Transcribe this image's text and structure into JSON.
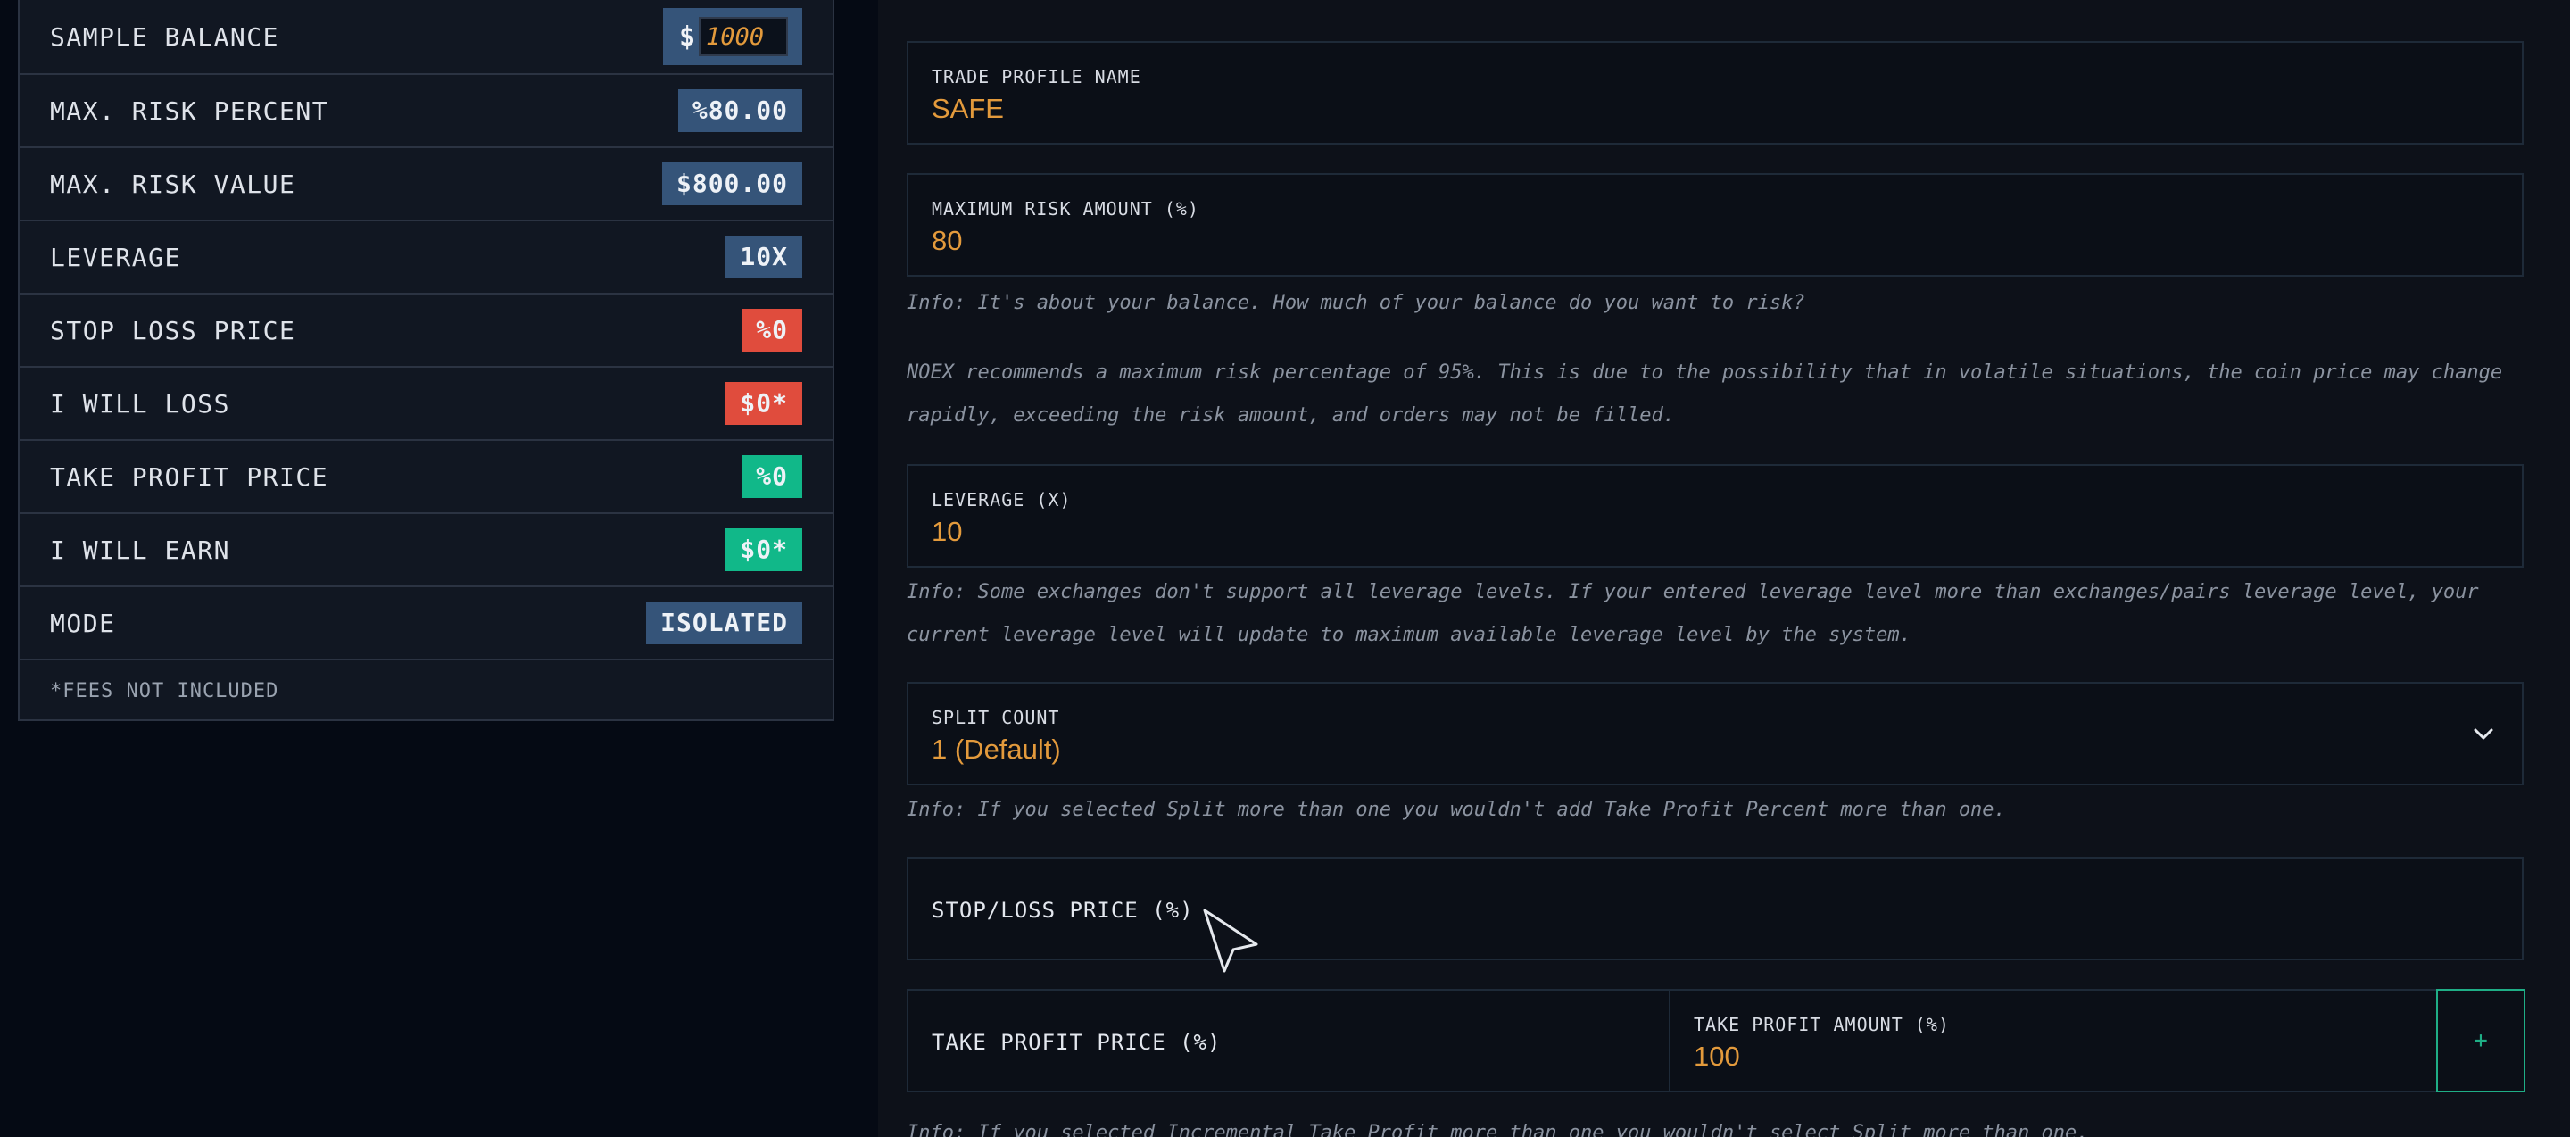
{
  "summary": {
    "rows": [
      {
        "label": "SAMPLE BALANCE",
        "currency": "$",
        "value": "1000"
      },
      {
        "label": "MAX. RISK PERCENT",
        "value": "%80.00"
      },
      {
        "label": "MAX. RISK VALUE",
        "value": "$800.00"
      },
      {
        "label": "LEVERAGE",
        "value": "10X"
      },
      {
        "label": "STOP LOSS PRICE",
        "value": "%0"
      },
      {
        "label": "I WILL LOSS",
        "value": "$0*"
      },
      {
        "label": "TAKE PROFIT PRICE",
        "value": "%0"
      },
      {
        "label": "I WILL EARN",
        "value": "$0*"
      },
      {
        "label": "MODE",
        "value": "ISOLATED"
      }
    ],
    "footnote": "*FEES NOT INCLUDED"
  },
  "form": {
    "profile_name": {
      "label": "TRADE PROFILE NAME",
      "value": "SAFE"
    },
    "max_risk": {
      "label": "MAXIMUM RISK AMOUNT (%)",
      "value": "80"
    },
    "max_risk_info_1": "Info: It's about your balance. How much of your balance do you want to risk?",
    "max_risk_info_2": "NOEX recommends a maximum risk percentage of 95%. This is due to the possibility that in volatile situations, the coin price may change rapidly, exceeding the risk amount, and orders may not be filled.",
    "leverage": {
      "label": "LEVERAGE (X)",
      "value": "10"
    },
    "leverage_info": "Info: Some exchanges don't support all leverage levels. If your entered leverage level more than exchanges/pairs leverage level, your current leverage level will update to maximum available leverage level by the system.",
    "split_count": {
      "label": "SPLIT COUNT",
      "value": "1 (Default)"
    },
    "split_info": "Info: If you selected Split more than one you wouldn't add Take Profit Percent more than one.",
    "stop_loss": {
      "label": "STOP/LOSS PRICE (%)"
    },
    "take_profit_price": {
      "label": "TAKE PROFIT PRICE (%)"
    },
    "take_profit_amount": {
      "label": "TAKE PROFIT AMOUNT (%)",
      "value": "100"
    },
    "add_button": "+",
    "tp_info": "Info: If you selected Incremental Take Profit more than one you wouldn't select Split more than one."
  },
  "icons": {
    "chevron": "chevron-down-icon",
    "cursor": "mouse-pointer-icon"
  },
  "colors": {
    "accent": "#e39a3c",
    "blue_badge": "#355479",
    "red_badge": "#e04c3d",
    "green_badge": "#11b889"
  }
}
